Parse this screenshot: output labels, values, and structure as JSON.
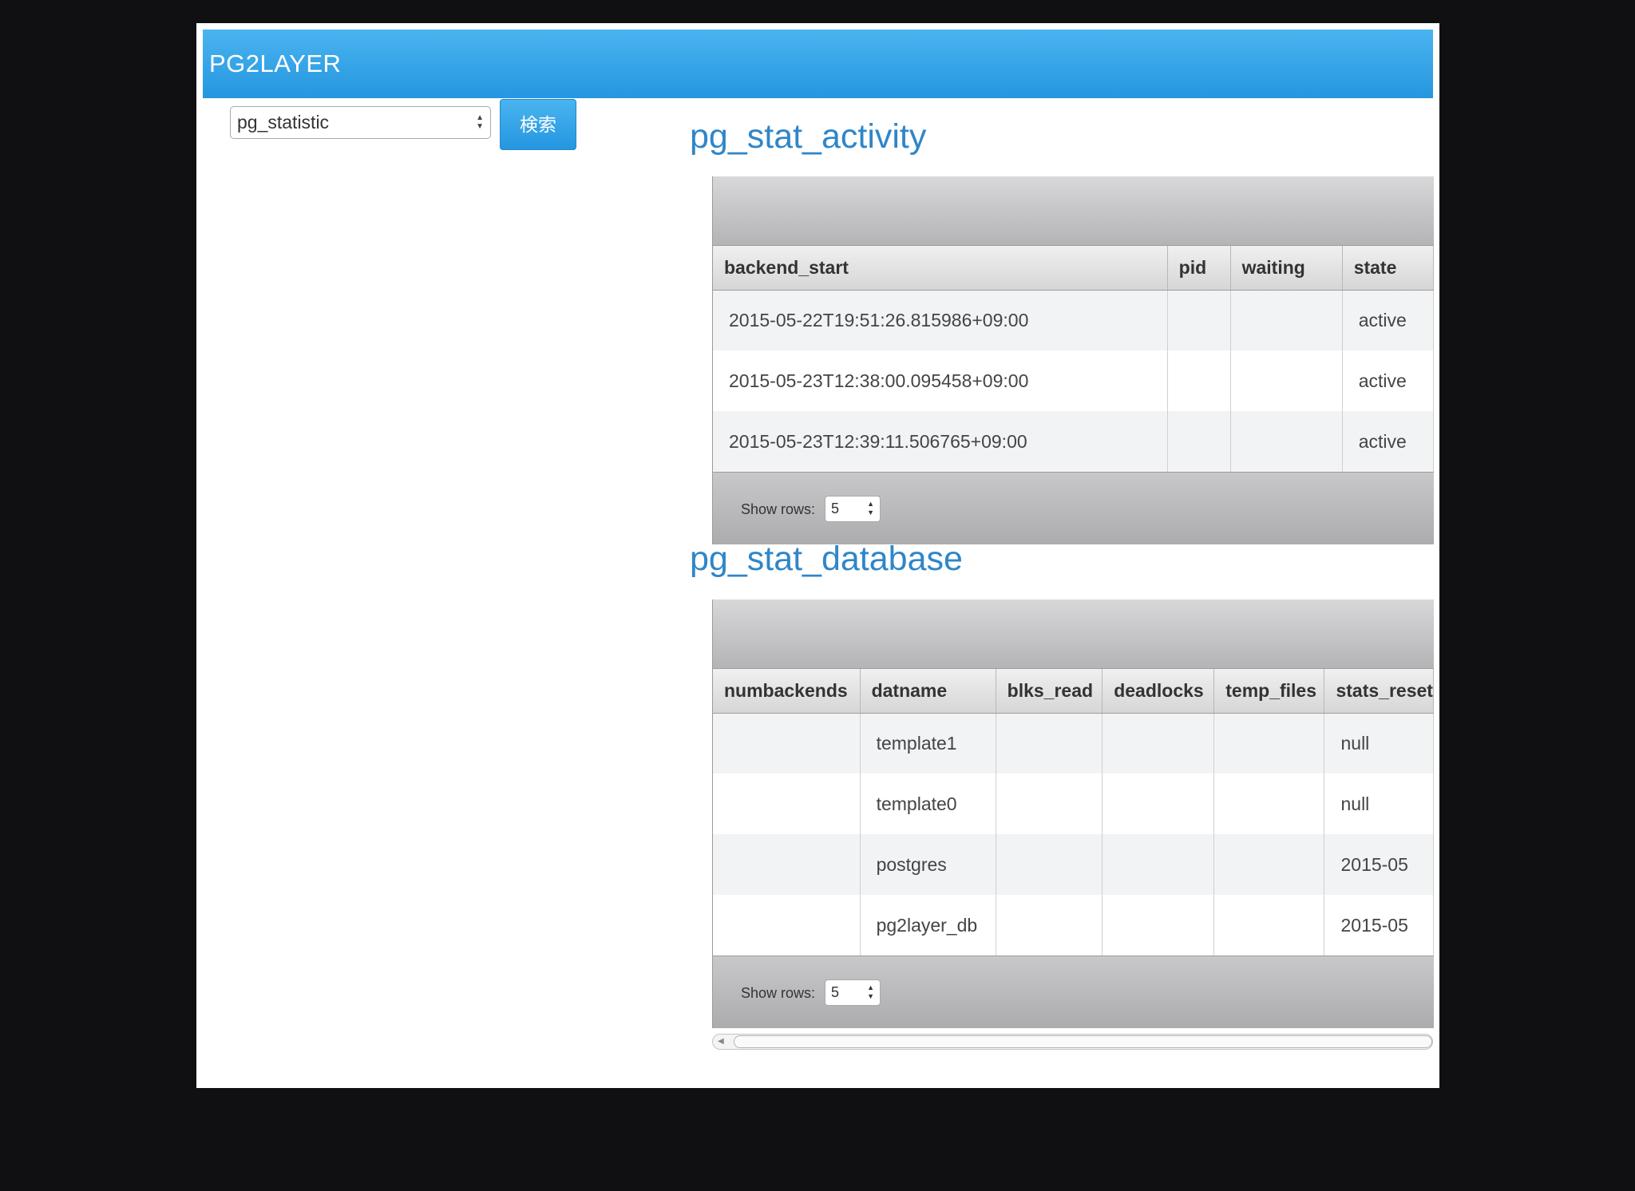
{
  "header": {
    "title": "PG2LAYER"
  },
  "search": {
    "selected_table": "pg_statistic",
    "button_label": "検索"
  },
  "activity": {
    "title": "pg_stat_activity",
    "columns": [
      "backend_start",
      "pid",
      "waiting",
      "state"
    ],
    "rows": [
      [
        "2015-05-22T19:51:26.815986+09:00",
        "",
        "",
        "active"
      ],
      [
        "2015-05-23T12:38:00.095458+09:00",
        "",
        "",
        "active"
      ],
      [
        "2015-05-23T12:39:11.506765+09:00",
        "",
        "",
        "active"
      ]
    ],
    "footer": {
      "show_rows_label": "Show rows:",
      "rows_value": "5"
    }
  },
  "database": {
    "title": "pg_stat_database",
    "columns": [
      "numbackends",
      "datname",
      "blks_read",
      "deadlocks",
      "temp_files",
      "stats_reset"
    ],
    "rows": [
      [
        "",
        "template1",
        "",
        "",
        "",
        "null"
      ],
      [
        "",
        "template0",
        "",
        "",
        "",
        "null"
      ],
      [
        "",
        "postgres",
        "",
        "",
        "",
        "2015-05"
      ],
      [
        "",
        "pg2layer_db",
        "",
        "",
        "",
        "2015-05"
      ]
    ],
    "footer": {
      "show_rows_label": "Show rows:",
      "rows_value": "5"
    }
  }
}
